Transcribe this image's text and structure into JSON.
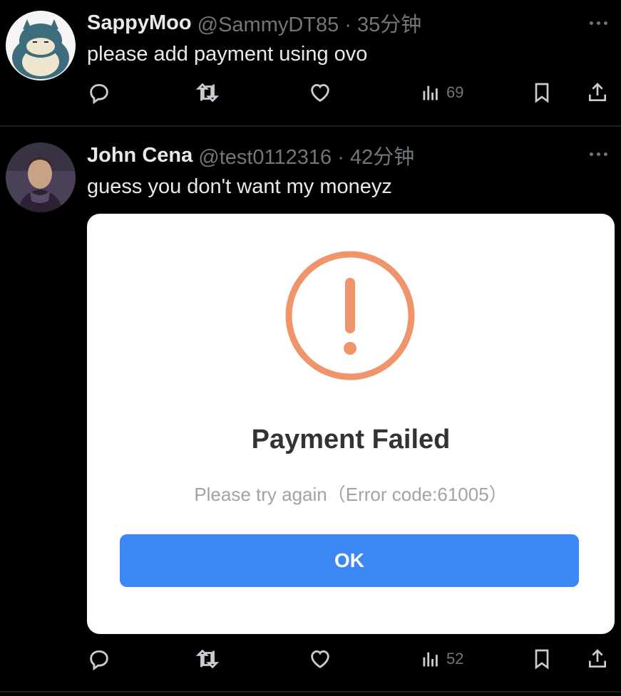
{
  "tweets": [
    {
      "display_name": "SappyMoo",
      "handle_meta": "@SammyDT85 · 35分钟",
      "text": "please add payment using ovo",
      "views": "69"
    },
    {
      "display_name": "John Cena",
      "handle_meta": "@test0112316 · 42分钟",
      "text": "guess you don't want my moneyz",
      "views": "52",
      "media": {
        "title": "Payment Failed",
        "message": "Please try again（Error code:61005）",
        "button": "OK",
        "accent": "#f0956b",
        "button_color": "#3b88f5"
      }
    }
  ],
  "icons": [
    "reply-icon",
    "retweet-icon",
    "like-icon",
    "views-icon",
    "bookmark-icon",
    "share-icon",
    "more-icon",
    "warning-icon"
  ]
}
